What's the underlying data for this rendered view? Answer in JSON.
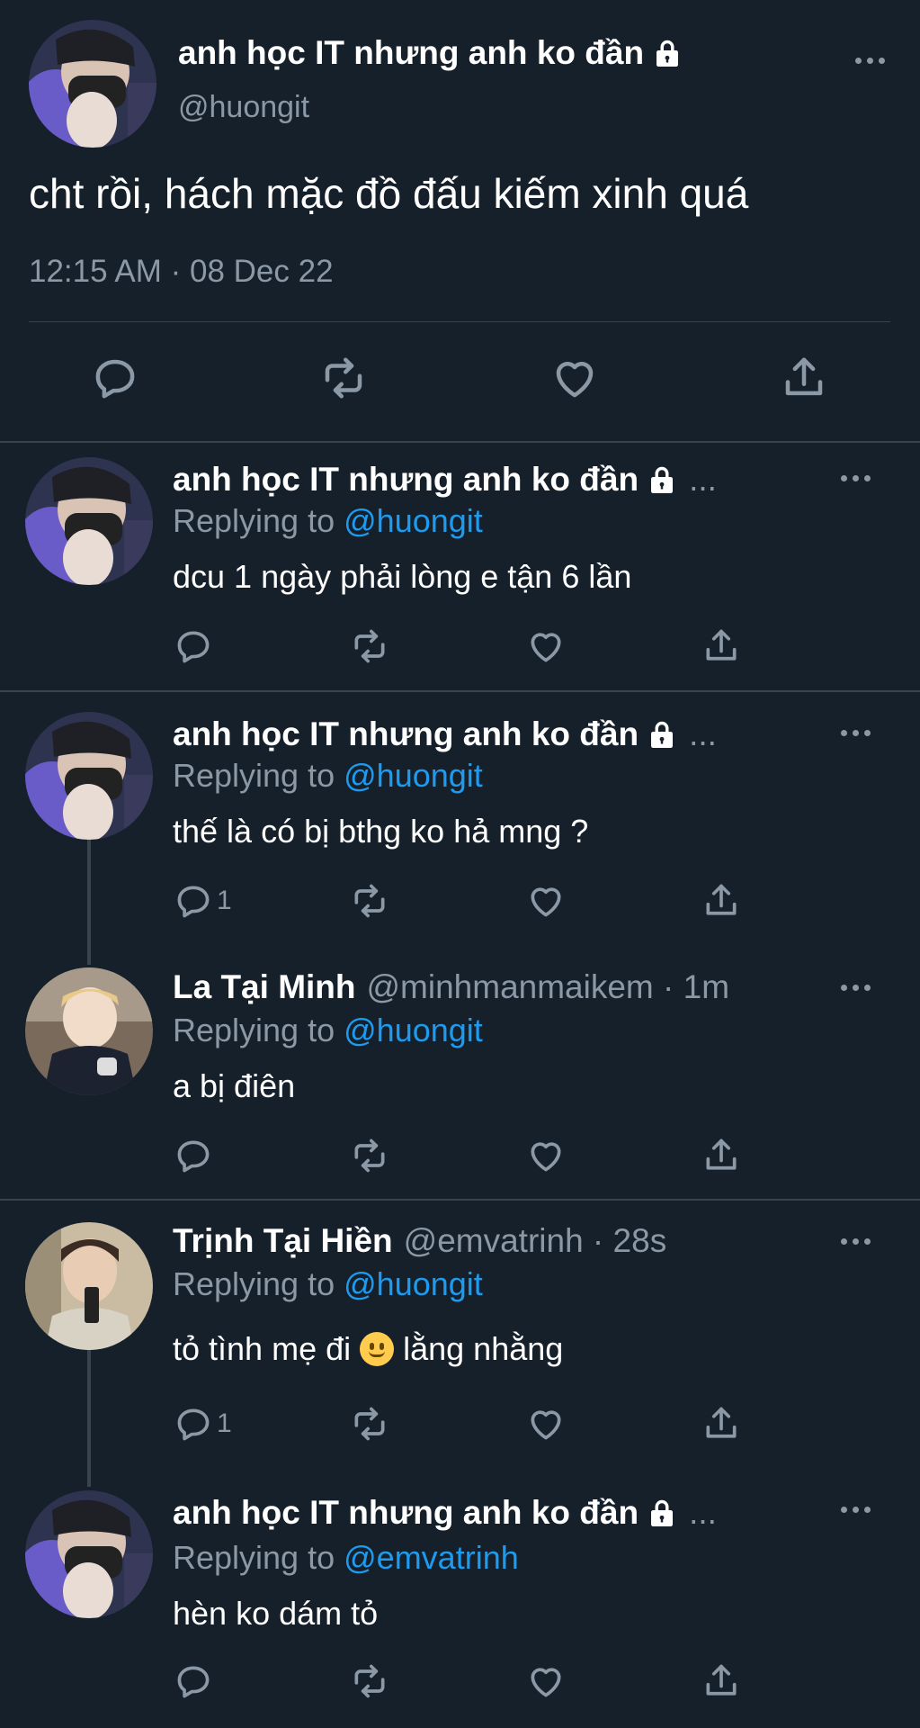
{
  "main_tweet": {
    "name": "anh học IT nhưng anh ko đần",
    "handle": "@huongit",
    "text": "cht rồi, hách mặc đồ đấu kiếm xinh quá",
    "timestamp": "12:15 AM · 08 Dec 22"
  },
  "replies": [
    {
      "name": "anh học IT nhưng anh ko đần",
      "meta": "...",
      "replying_label": "Replying to",
      "replying_handle": "@huongit",
      "text": "dcu 1 ngày phải lòng e tận 6 lần",
      "reply_count": ""
    },
    {
      "name": "anh học IT nhưng anh ko đần",
      "meta": "...",
      "replying_label": "Replying to",
      "replying_handle": "@huongit",
      "text": "thế là có bị bthg ko hả mng ?",
      "reply_count": "1"
    },
    {
      "name": "La Tại Minh",
      "meta": "@minhmanmaikem · 1m",
      "replying_label": "Replying to",
      "replying_handle": "@huongit",
      "text": "a bị điên",
      "reply_count": ""
    },
    {
      "name": "Trịnh Tại Hiền",
      "meta": "@emvatrinh · 28s",
      "replying_label": "Replying to",
      "replying_handle": "@huongit",
      "text_before": "tỏ tình mẹ đi",
      "emoji": "slightly-smiling-face",
      "text_after": "lằng nhằng",
      "reply_count": "1"
    },
    {
      "name": "anh học IT nhưng anh ko đần",
      "meta": "...",
      "replying_label": "Replying to",
      "replying_handle": "@emvatrinh",
      "text": "hèn ko dám tỏ",
      "reply_count": ""
    }
  ],
  "colors": {
    "background": "#15202b",
    "divider": "#38444d",
    "muted": "#8b98a5",
    "link": "#1d9bf0"
  },
  "icons": [
    "reply-icon",
    "retweet-icon",
    "like-icon",
    "share-icon",
    "more-icon",
    "lock-icon"
  ]
}
